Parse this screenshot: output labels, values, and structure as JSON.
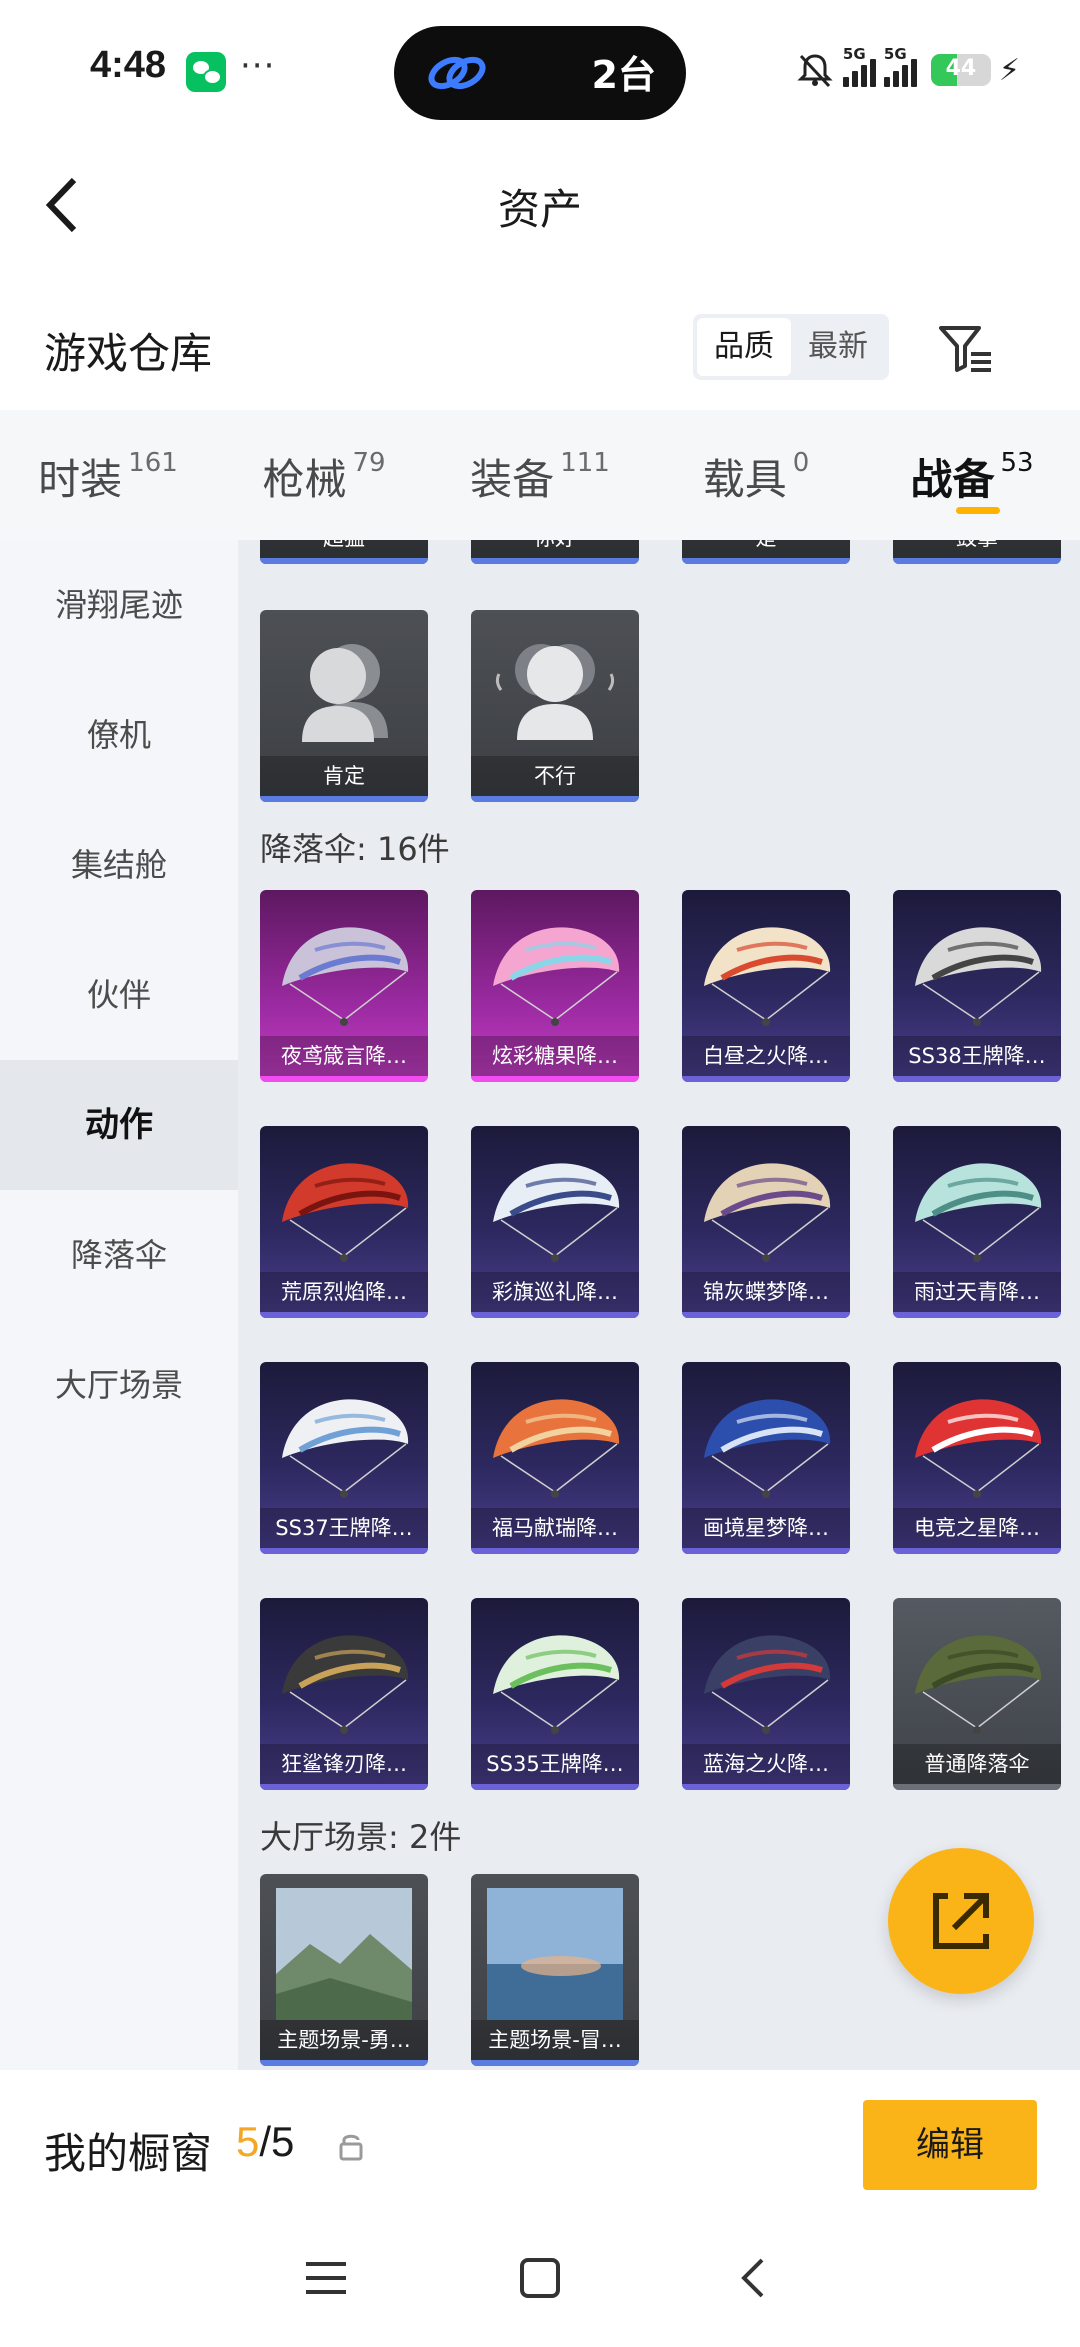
{
  "status_bar": {
    "time": "4:48",
    "dots": "···",
    "island_text": "2台",
    "signal_label": "5G",
    "battery": "44",
    "battery_level": 0.44
  },
  "header": {
    "title": "资产"
  },
  "section": {
    "title": "游戏仓库",
    "sort_options": [
      "品质",
      "最新"
    ],
    "sort_selected": "品质"
  },
  "tabs": [
    {
      "name": "时装",
      "count": "161"
    },
    {
      "name": "枪械",
      "count": "79"
    },
    {
      "name": "装备",
      "count": "111"
    },
    {
      "name": "载具",
      "count": "0"
    },
    {
      "name": "战备",
      "count": "53",
      "active": true
    }
  ],
  "sidebar": {
    "items": [
      "滑翔尾迹",
      "僚机",
      "集结舱",
      "伙伴",
      "动作",
      "降落伞",
      "大厅场景"
    ],
    "active": "动作"
  },
  "content": {
    "partial_row": [
      "超猛",
      "你好",
      "是",
      "鼓掌"
    ],
    "actions": [
      {
        "label": "肯定"
      },
      {
        "label": "不行"
      }
    ],
    "parachute_header": "降落伞: 16件",
    "parachutes": [
      {
        "label": "夜鸢箴言降…",
        "rarity": "pink"
      },
      {
        "label": "炫彩糖果降…",
        "rarity": "pink"
      },
      {
        "label": "白昼之火降…",
        "rarity": "purple"
      },
      {
        "label": "SS38王牌降…",
        "rarity": "purple"
      },
      {
        "label": "荒原烈焰降…",
        "rarity": "purple"
      },
      {
        "label": "彩旗巡礼降…",
        "rarity": "purple"
      },
      {
        "label": "锦灰蝶梦降…",
        "rarity": "purple"
      },
      {
        "label": "雨过天青降…",
        "rarity": "purple"
      },
      {
        "label": "SS37王牌降…",
        "rarity": "purple"
      },
      {
        "label": "福马献瑞降…",
        "rarity": "purple"
      },
      {
        "label": "画境星梦降…",
        "rarity": "purple"
      },
      {
        "label": "电竞之星降…",
        "rarity": "purple"
      },
      {
        "label": "狂鲨锋刃降…",
        "rarity": "purple"
      },
      {
        "label": "SS35王牌降…",
        "rarity": "purple"
      },
      {
        "label": "蓝海之火降…",
        "rarity": "purple"
      },
      {
        "label": "普通降落伞",
        "rarity": "plain"
      }
    ],
    "lobby_header": "大厅场景: 2件",
    "lobby_scenes": [
      {
        "label": "主题场景-勇…"
      },
      {
        "label": "主题场景-冒…"
      }
    ]
  },
  "showcase": {
    "label": "我的橱窗",
    "current": "5",
    "total": "/5",
    "edit_label": "编辑"
  },
  "colors": {
    "accent": "#fbb417",
    "purple_rarity": "#6b62d8",
    "pink_rarity": "#f04cf0"
  }
}
